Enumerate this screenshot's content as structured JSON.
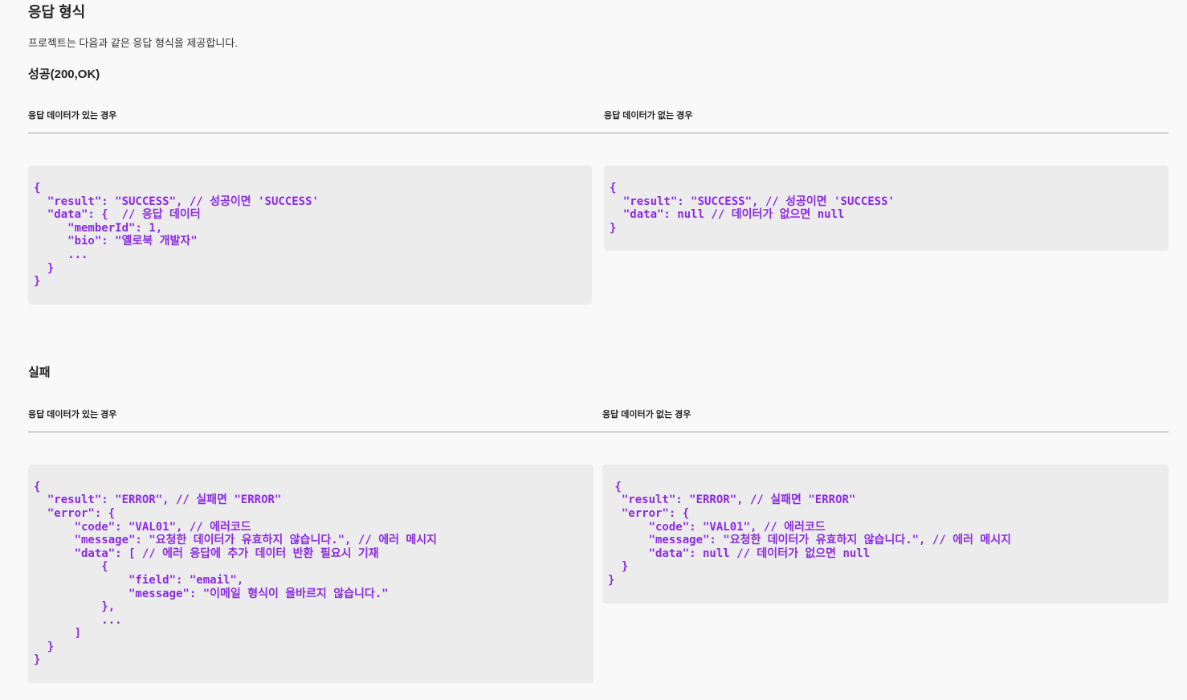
{
  "page": {
    "title": "응답 형식",
    "description": "프로젝트는 다음과 같은 응답 형식을 제공합니다."
  },
  "sections": [
    {
      "heading": "성공(200,OK)",
      "columns": [
        {
          "label": "응답 데이터가 있는 경우",
          "code": "{\n  \"result\": \"SUCCESS\", // 성공이면 'SUCCESS'\n  \"data\": {  // 응답 데이터\n     \"memberId\": 1,\n     \"bio\": \"옐로북 개발자\"\n     ...\n  }\n}"
        },
        {
          "label": "응답 데이터가 없는 경우",
          "code": "{\n  \"result\": \"SUCCESS\", // 성공이면 'SUCCESS'\n  \"data\": null // 데이터가 없으면 null\n}"
        }
      ]
    },
    {
      "heading": "실패",
      "columns": [
        {
          "label": "응답 데이터가 있는 경우",
          "code": "{\n  \"result\": \"ERROR\", // 실패면 \"ERROR\"\n  \"error\": {\n      \"code\": \"VAL01\", // 에러코드\n      \"message\": \"요청한 데이터가 유효하지 않습니다.\", // 에러 메시지\n      \"data\": [ // 에러 응답에 추가 데이터 반환 필요시 기재\n          {\n              \"field\": \"email\",\n              \"message\": \"이메일 형식이 올바르지 않습니다.\"\n          },\n          ...\n      ]\n  }\n}"
        },
        {
          "label": "응답 데이터가 없는 경우",
          "code": " {\n  \"result\": \"ERROR\", // 실패면 \"ERROR\"\n  \"error\": {\n      \"code\": \"VAL01\", // 에러코드\n      \"message\": \"요청한 데이터가 유효하지 않습니다.\", // 에러 메시지\n      \"data\": null // 데이터가 없으면 null\n  }\n}"
        }
      ]
    }
  ],
  "theme": {
    "page_background": "#f9f9f9",
    "code_background": "#ececec",
    "code_text": "#8a2be2",
    "text": "#222222",
    "rule": "#a3a3a3"
  }
}
